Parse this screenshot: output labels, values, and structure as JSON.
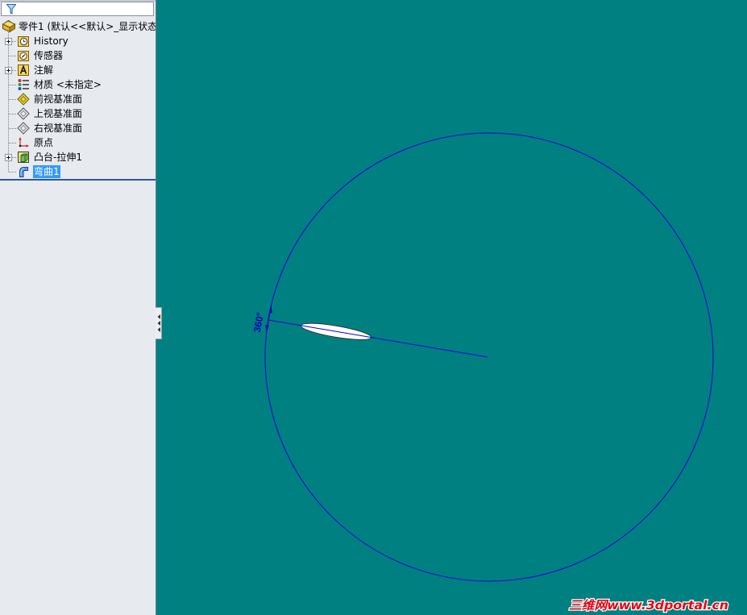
{
  "filter": {
    "icon": "funnel-icon"
  },
  "feature_tree": {
    "root": {
      "label": "零件1 (默认<<默认>_显示状态",
      "icon": "part-icon"
    },
    "items": [
      {
        "label": "History",
        "icon": "history-icon",
        "expandable": true
      },
      {
        "label": "传感器",
        "icon": "sensor-icon",
        "expandable": false
      },
      {
        "label": "注解",
        "icon": "annotation-icon",
        "expandable": true
      },
      {
        "label": "材质 <未指定>",
        "icon": "material-icon",
        "expandable": false
      },
      {
        "label": "前视基准面",
        "icon": "plane-icon",
        "expandable": false
      },
      {
        "label": "上视基准面",
        "icon": "plane-icon",
        "expandable": false
      },
      {
        "label": "右视基准面",
        "icon": "plane-icon",
        "expandable": false
      },
      {
        "label": "原点",
        "icon": "origin-icon",
        "expandable": false
      },
      {
        "label": "凸台-拉伸1",
        "icon": "extrude-icon",
        "expandable": true
      },
      {
        "label": "弯曲1",
        "icon": "flex-icon",
        "expandable": false,
        "selected": true
      }
    ]
  },
  "panel_toggle": {
    "icon": "collapse-arrows-icon"
  },
  "graphics_area": {
    "dimension_label": "360°",
    "watermark": "三维网www.3dportal.cn"
  },
  "colors": {
    "panel_background": "#e7eaef",
    "selection": "#3399ff",
    "viewport_background": "#008080",
    "sketch_blue": "#0000dd",
    "dimension_blue": "#0000b4",
    "watermark_red": "#e60012"
  }
}
